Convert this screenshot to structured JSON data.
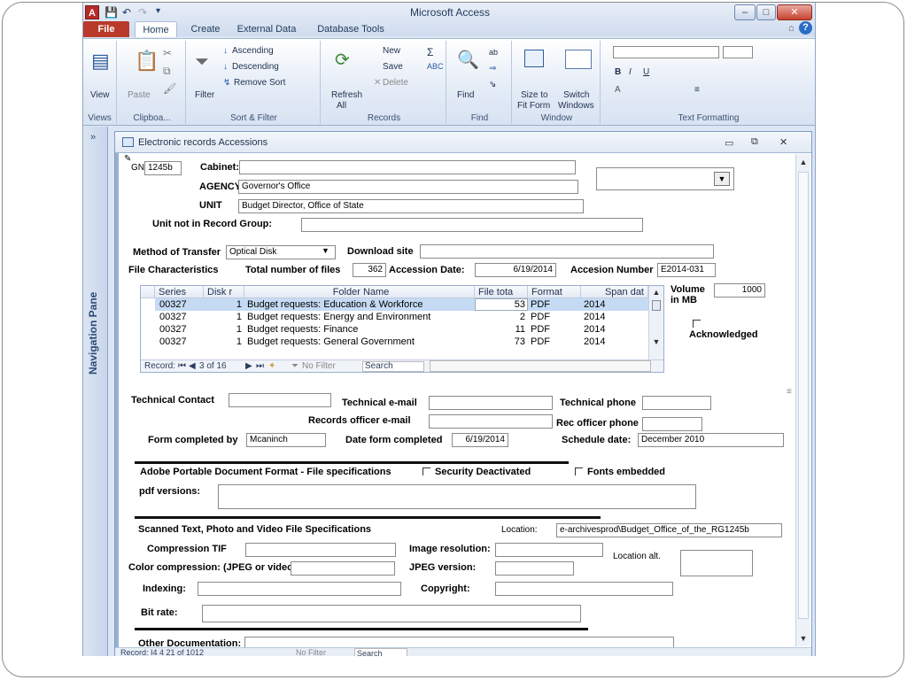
{
  "app": {
    "title": "Microsoft Access",
    "logo": "A",
    "quick_access": [
      "💾",
      "↶",
      "↷",
      "▾"
    ],
    "window_controls": [
      "–",
      "□",
      "✕"
    ],
    "help_icon": "?"
  },
  "tabs": [
    "File",
    "Home",
    "Create",
    "External Data",
    "Database Tools"
  ],
  "ribbon": {
    "views": {
      "group": "Views",
      "view_label": "View"
    },
    "clipboard": {
      "group": "Clipboa...",
      "paste_label": "Paste"
    },
    "sort_filter": {
      "group": "Sort & Filter",
      "filter_label": "Filter",
      "ascending": "Ascending",
      "descending": "Descending",
      "remove_sort": "Remove Sort"
    },
    "records": {
      "group": "Records",
      "refresh_label": "Refresh",
      "refresh_sub": "All",
      "new_label": "New",
      "save_label": "Save",
      "delete_label": "Delete"
    },
    "find": {
      "group": "Find",
      "find_label": "Find"
    },
    "window": {
      "group": "Window",
      "size_label": "Size to",
      "size_sub": "Fit Form",
      "switch_label": "Switch",
      "switch_sub": "Windows"
    },
    "text_formatting": {
      "group": "Text Formatting"
    }
  },
  "nav_pane": {
    "label": "Navigation Pane",
    "collapse": "»"
  },
  "form": {
    "title": "Electronic records Accessions",
    "gn_label": "GNI",
    "gn_value": "1245b",
    "cabinet_label": "Cabinet:",
    "cabinet_value": "",
    "agency_label": "AGENCY:",
    "agency_value": "Governor's Office",
    "unit_label": "UNIT",
    "unit_value": "Budget Director, Office of State",
    "unit_not_label": "Unit not in Record Group:",
    "method_label": "Method of Transfer",
    "method_value": "Optical Disk",
    "download_label": "Download site",
    "file_char_label": "File Characteristics",
    "total_files_label": "Total number of files",
    "total_files_value": "362",
    "accession_date_label": "Accession Date:",
    "accession_date_value": "6/19/2014",
    "accession_num_label": "Accesion Number",
    "accession_num_value": "E2014-031",
    "volume_label": "Volume",
    "volume_label2": "in MB",
    "volume_value": "1000",
    "acknowledged_label": "Acknowledged",
    "tech_contact_label": "Technical Contact",
    "tech_email_label": "Technical e-mail",
    "tech_phone_label": "Technical phone",
    "rec_email_label": "Records officer e-mail",
    "rec_phone_label": "Rec officer phone",
    "form_completed_label": "Form completed by",
    "form_completed_value": "Mcaninch",
    "date_completed_label": "Date form completed",
    "date_completed_value": "6/19/2014",
    "schedule_label": "Schedule date:",
    "schedule_value": "December 2010",
    "pdf_section_label": "Adobe Portable Document Format  - File specifications",
    "security_label": "Security Deactivated",
    "fonts_label": "Fonts embedded",
    "pdf_versions_label": "pdf versions:",
    "scanned_label": "Scanned Text, Photo and Video File Specifications",
    "location_label": "Location:",
    "location_value": "e-archivesprod\\Budget_Office_of_the_RG1245b",
    "compression_label": "Compression TIF",
    "image_res_label": "Image resolution:",
    "location_alt_label": "Location alt.",
    "color_comp_label": "Color compression: (JPEG or video)",
    "jpeg_version_label": "JPEG version:",
    "indexing_label": "Indexing:",
    "copyright_label": "Copyright:",
    "bitrate_label": "Bit rate:",
    "other_doc_label": "Other Documentation:"
  },
  "sheet": {
    "columns": [
      "Series",
      "Disk r",
      "Folder Name",
      "File tota",
      "Format",
      "Span dat"
    ],
    "rows": [
      {
        "series": "00327",
        "disk": "1",
        "folder": "Budget requests: Education & Workforce",
        "files": "53",
        "format": "PDF",
        "span": "2014"
      },
      {
        "series": "00327",
        "disk": "1",
        "folder": "Budget requests: Energy and Environment",
        "files": "2",
        "format": "PDF",
        "span": "2014"
      },
      {
        "series": "00327",
        "disk": "1",
        "folder": "Budget requests: Finance",
        "files": "11",
        "format": "PDF",
        "span": "2014"
      },
      {
        "series": "00327",
        "disk": "1",
        "folder": "Budget requests: General Government",
        "files": "73",
        "format": "PDF",
        "span": "2014"
      }
    ],
    "nav_record_label": "Record:",
    "nav_position": "3 of 16",
    "nav_filter": "No Filter",
    "nav_search": "Search"
  },
  "bottom_nav": {
    "record_text": "Record: I4  4  21 of 1012",
    "filter": "No Filter",
    "search": "Search"
  }
}
